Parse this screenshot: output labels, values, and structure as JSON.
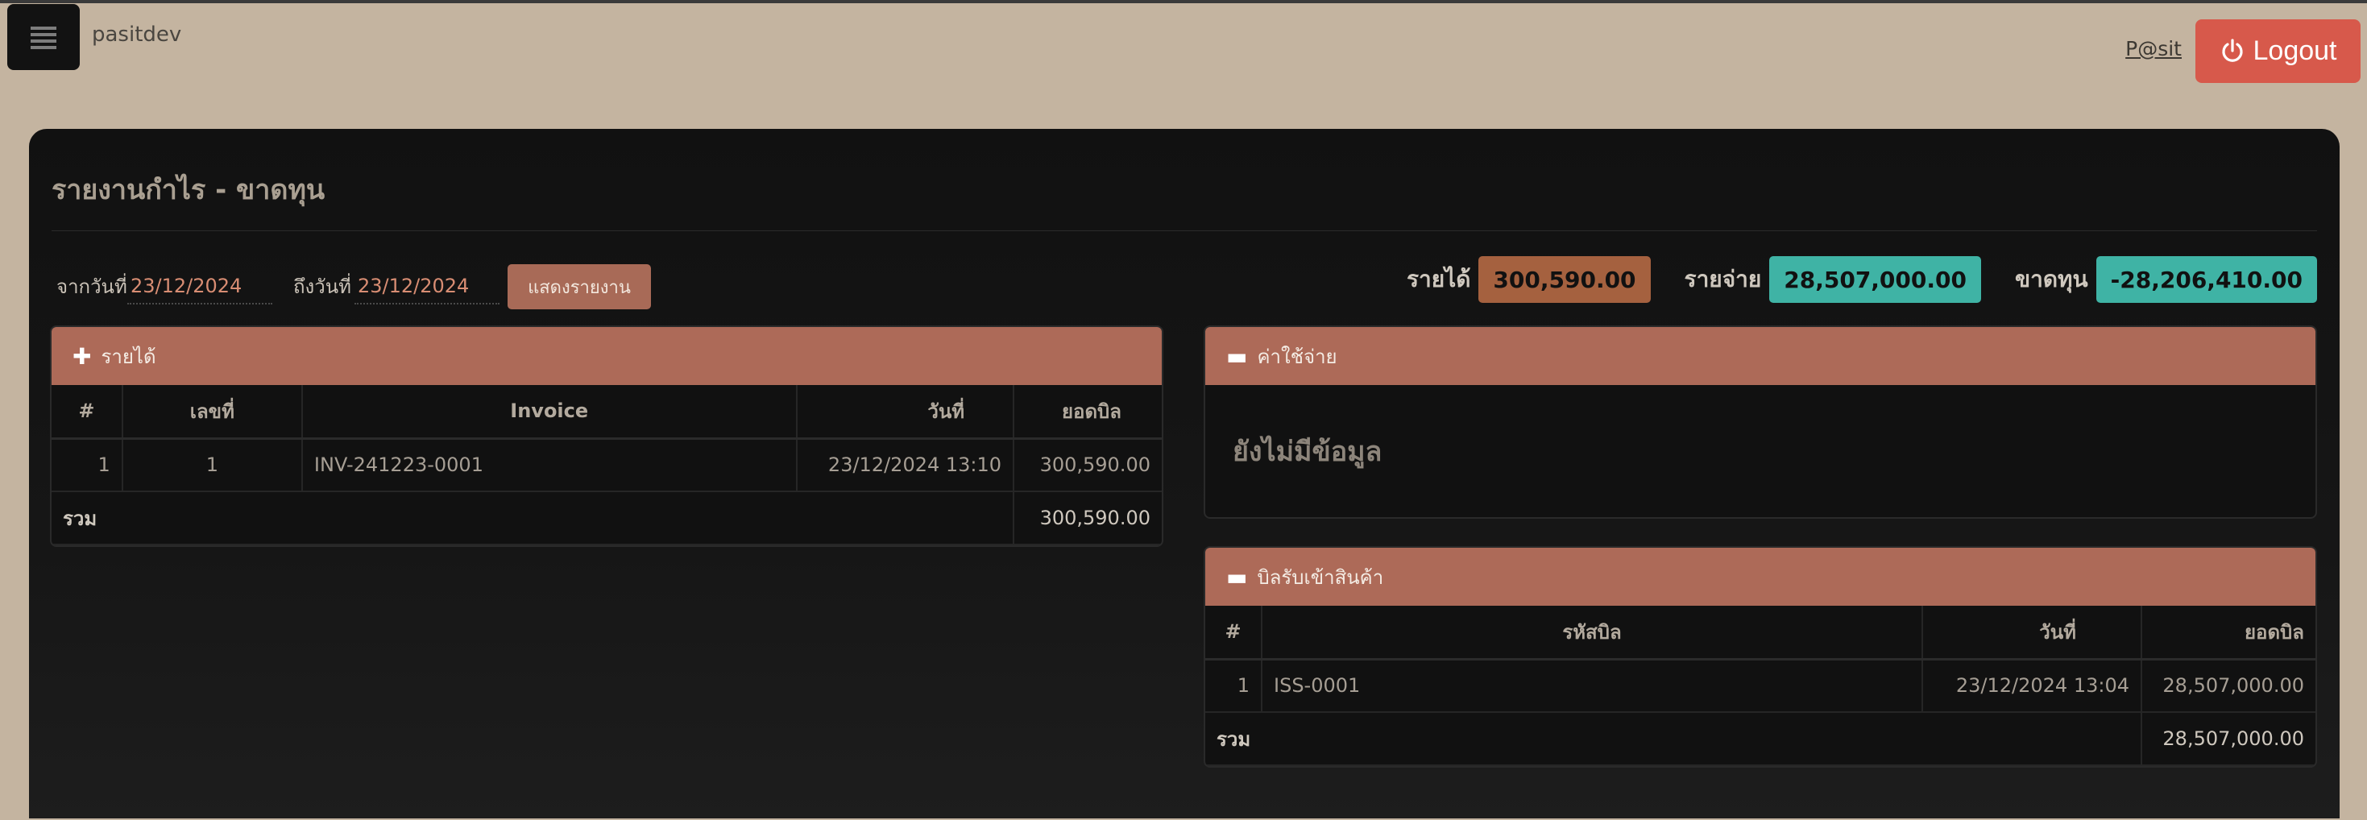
{
  "header": {
    "menu_icon": "hamburger-icon",
    "username": "pasitdev",
    "user_link": "P@sit",
    "logout_label": "Logout",
    "logout_icon": "power-icon"
  },
  "page": {
    "title": "รายงานกำไร - ขาดทุน"
  },
  "filter": {
    "from_label": "จากวันที่",
    "from_value": "23/12/2024",
    "to_label": "ถึงวันที่",
    "to_value": "23/12/2024",
    "show_button": "แสดงรายงาน"
  },
  "summary": {
    "income_label": "รายได้",
    "income_value": "300,590.00",
    "income_color": "#a5613f",
    "expense_label": "รายจ่าย",
    "expense_value": "28,507,000.00",
    "expense_color": "#3fb3a5",
    "loss_label": "ขาดทุน",
    "loss_value": "-28,206,410.00",
    "loss_color": "#3fb3a5"
  },
  "income_card": {
    "title": "รายได้",
    "icon": "plus-icon",
    "columns": [
      "#",
      "เลขที่",
      "Invoice",
      "วันที่",
      "ยอดบิล"
    ],
    "rows": [
      [
        "1",
        "1",
        "INV-241223-0001",
        "23/12/2024 13:10",
        "300,590.00"
      ]
    ],
    "total_label": "รวม",
    "total_value": "300,590.00"
  },
  "expense_card": {
    "title": "ค่าใช้จ่าย",
    "icon": "minus-icon",
    "empty_text": "ยังไม่มีข้อมูล"
  },
  "receipt_card": {
    "title": "บิลรับเข้าสินค้า",
    "icon": "minus-icon",
    "columns": [
      "#",
      "รหัสบิล",
      "วันที่",
      "ยอดบิล"
    ],
    "rows": [
      [
        "1",
        "ISS-0001",
        "23/12/2024 13:04",
        "28,507,000.00"
      ]
    ],
    "total_label": "รวม",
    "total_value": "28,507,000.00"
  }
}
